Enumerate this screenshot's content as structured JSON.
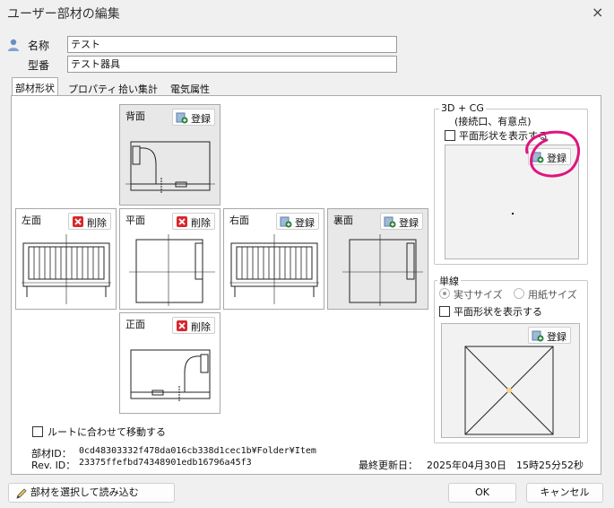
{
  "window": {
    "title": "ユーザー部材の編集",
    "close": "×"
  },
  "fields": {
    "name_label": "名称",
    "name_value": "テスト",
    "model_label": "型番",
    "model_value": "テスト器具"
  },
  "tabs": [
    {
      "label": "部材形状",
      "active": true
    },
    {
      "label": "プロパティ",
      "active": false
    },
    {
      "label": "拾い集計",
      "active": false
    },
    {
      "label": "電気属性",
      "active": false
    }
  ],
  "views": {
    "back": {
      "label": "背面",
      "button": "登録"
    },
    "left": {
      "label": "左面",
      "button": "削除"
    },
    "plane": {
      "label": "平面",
      "button": "削除"
    },
    "right": {
      "label": "右面",
      "button": "登録"
    },
    "rear": {
      "label": "裏面",
      "button": "登録"
    },
    "front": {
      "label": "正面",
      "button": "削除"
    }
  },
  "group_3dcg": {
    "title": "3D + CG",
    "subtitle": "(接続口、有意点)",
    "checkbox_label": "平面形状を表示する",
    "register_button": "登録"
  },
  "group_single": {
    "title": "単線",
    "radio_actual": "実寸サイズ",
    "radio_paper": "用紙サイズ",
    "checkbox_label": "平面形状を表示する",
    "register_button": "登録"
  },
  "route_checkbox": "ルートに合わせて移動する",
  "ids": {
    "part_id_label": "部材ID：",
    "part_id_value": "0cd48303332f478da016cb338d1cec1b¥Folder¥Item",
    "rev_id_label": "Rev. ID：",
    "rev_id_value": "23375ffefbd74348901edb16796a45f3",
    "updated_label": "最終更新日：",
    "updated_value": "2025年04月30日　15時25分52秒"
  },
  "buttons": {
    "load": "部材を選択して読み込む",
    "ok": "OK",
    "cancel": "キャンセル"
  },
  "colors": {
    "annotation": "#e0147e",
    "delete_icon": "#d9262b",
    "register_icon": "#2a7d3b"
  }
}
